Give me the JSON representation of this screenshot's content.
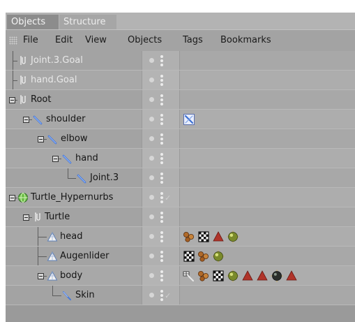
{
  "tabs": [
    {
      "label": "Objects",
      "active": true
    },
    {
      "label": "Structure",
      "active": false
    }
  ],
  "menu": [
    "File",
    "Edit",
    "View",
    "Objects",
    "Tags",
    "Bookmarks"
  ],
  "rows": [
    {
      "name": "Joint.3.Goal",
      "dim": true,
      "icon": "null-object-icon",
      "tags": []
    },
    {
      "name": "hand.Goal",
      "dim": true,
      "icon": "null-object-icon",
      "tags": []
    },
    {
      "name": "Root",
      "dim": false,
      "icon": "null-object-icon",
      "tags": []
    },
    {
      "name": "shoulder",
      "dim": false,
      "icon": "bone-icon",
      "tags": [
        "ik-tag-icon"
      ]
    },
    {
      "name": "elbow",
      "dim": false,
      "icon": "bone-icon",
      "tags": []
    },
    {
      "name": "hand",
      "dim": false,
      "icon": "bone-icon",
      "tags": []
    },
    {
      "name": "Joint.3",
      "dim": false,
      "icon": "bone-icon",
      "tags": []
    },
    {
      "name": "Turtle_Hypernurbs",
      "dim": false,
      "icon": "hypernurbs-icon",
      "tags": []
    },
    {
      "name": "Turtle",
      "dim": false,
      "icon": "null-object-icon",
      "tags": []
    },
    {
      "name": "head",
      "dim": false,
      "icon": "polygon-object-icon",
      "tags": [
        "uvw-tag-icon",
        "texture-tag-icon",
        "selection-tag-icon",
        "material-tag-icon"
      ]
    },
    {
      "name": "Augenlider",
      "dim": false,
      "icon": "polygon-object-icon",
      "tags": [
        "texture-tag-icon",
        "uvw-tag-icon",
        "material-tag-icon"
      ]
    },
    {
      "name": "body",
      "dim": false,
      "icon": "polygon-object-icon",
      "tags": [
        "weight-tag-icon",
        "uvw-tag-icon",
        "texture-tag-icon",
        "material-tag-icon",
        "selection-tag-icon",
        "selection-tag-icon",
        "dark-material-tag-icon",
        "selection-tag-icon"
      ]
    },
    {
      "name": "Skin",
      "dim": false,
      "icon": "skin-deformer-icon",
      "tags": []
    }
  ]
}
